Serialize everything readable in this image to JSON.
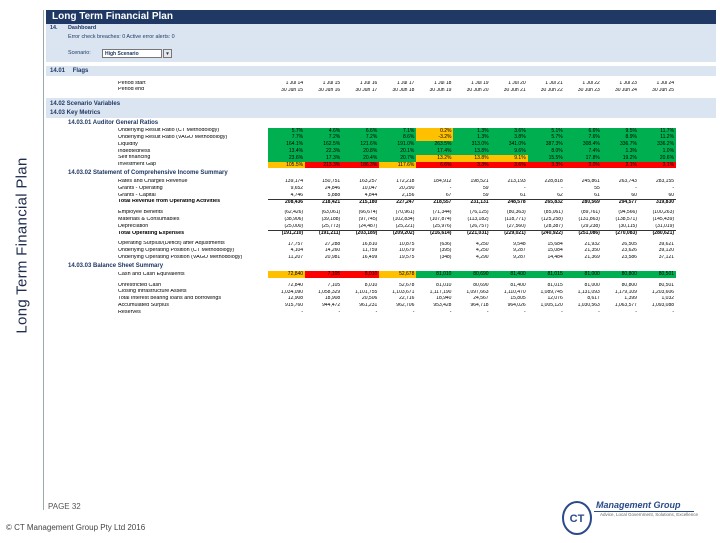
{
  "side_title": "Long Term Financial Plan",
  "sheet_title": "Long Term Financial Plan",
  "dashboard": {
    "number": "14.",
    "title": "Dashboard",
    "alerts": "Error check breaches: 0 Active error alerts: 0",
    "scenario_label": "Scenario:",
    "scenario_value": "High Scenario",
    "dropdown_glyph": "▾"
  },
  "flags": {
    "number": "14.01",
    "title": "Flags"
  },
  "periods": {
    "start_label": "Period start",
    "end_label": "Period end",
    "starts": [
      "1 Jul 14",
      "1 Jul 15",
      "1 Jul 16",
      "1 Jul 17",
      "1 Jul 18",
      "1 Jul 19",
      "1 Jul 20",
      "1 Jul 21",
      "1 Jul 22",
      "1 Jul 23",
      "1 Jul 24"
    ],
    "ends": [
      "30 Jun 15",
      "30 Jun 16",
      "30 Jun 17",
      "30 Jun 18",
      "30 Jun 19",
      "30 Jun 20",
      "30 Jun 21",
      "30 Jun 22",
      "30 Jun 23",
      "30 Jun 24",
      "30 Jun 25"
    ]
  },
  "scenario_vars": {
    "line1": "14.02 Scenario Variables",
    "line2": "14.03 Key Metrics"
  },
  "auditor": {
    "title": "14.03.01  Auditor General Ratios",
    "rows": [
      {
        "label": "Underlying Result Ratio (CT Methodology)",
        "values": [
          "5.7%",
          "4.6%",
          "6.6%",
          "7.1%",
          "0.2%",
          "1.3%",
          "3.6%",
          "5.1%",
          "6.6%",
          "9.5%",
          "11.7%"
        ],
        "colors": [
          "g",
          "g",
          "g",
          "g",
          "y",
          "g",
          "g",
          "g",
          "g",
          "g",
          "g"
        ]
      },
      {
        "label": "Underlying Result Ratio (VAGO Methodology)",
        "values": [
          "7.7%",
          "7.2%",
          "7.2%",
          "8.6%",
          "-3.2%",
          "1.3%",
          "3.8%",
          "5.7%",
          "7.6%",
          "8.9%",
          "11.2%"
        ],
        "colors": [
          "g",
          "g",
          "g",
          "g",
          "y",
          "g",
          "g",
          "g",
          "g",
          "g",
          "g"
        ]
      },
      {
        "label": "Liquidity",
        "values": [
          "164.1%",
          "162.5%",
          "121.6%",
          "191.0%",
          "263.5%",
          "313.0%",
          "341.0%",
          "387.3%",
          "308.4%",
          "336.7%",
          "336.2%"
        ],
        "colors": [
          "g",
          "g",
          "g",
          "g",
          "g",
          "g",
          "g",
          "g",
          "g",
          "g",
          "g"
        ]
      },
      {
        "label": "Indebtedness",
        "values": [
          "13.4%",
          "22.3%",
          "20.8%",
          "20.1%",
          "17.4%",
          "13.8%",
          "9.6%",
          "8.0%",
          "7.4%",
          "1.3%",
          "1.0%"
        ],
        "colors": [
          "g",
          "g",
          "g",
          "g",
          "g",
          "g",
          "g",
          "g",
          "g",
          "g",
          "g"
        ]
      },
      {
        "label": "Self financing",
        "values": [
          "23.6%",
          "17.3%",
          "20.4%",
          "20.7%",
          "13.2%",
          "13.8%",
          "9.1%",
          "15.5%",
          "17.8%",
          "19.2%",
          "20.6%"
        ],
        "colors": [
          "g",
          "g",
          "g",
          "g",
          "y",
          "y",
          "y",
          "g",
          "g",
          "g",
          "g"
        ]
      },
      {
        "label": "Investment Gap",
        "values": [
          "105.5%",
          "213.3%",
          "186.3%",
          "117.6%",
          "6.6%",
          "3.3%",
          "3.6%",
          "3.3%",
          "3.0%",
          "2.1%",
          "3.1%"
        ],
        "colors": [
          "y",
          "r",
          "r",
          "y",
          "r",
          "r",
          "r",
          "r",
          "r",
          "r",
          "r"
        ]
      }
    ]
  },
  "income": {
    "title": "14.03.02  Statement of Comprehensive Income Summary",
    "rows": [
      {
        "label": "Rates and Charges Revenue",
        "values": [
          "139,174",
          "150,751",
          "163,257",
          "172,218",
          "184,912",
          "198,521",
          "213,193",
          "228,818",
          "245,861",
          "263,743",
          "283,155"
        ],
        "style": ""
      },
      {
        "label": "Grants - Operating",
        "values": [
          "9,652",
          "24,846",
          "10,047",
          "20,290",
          "-",
          "59",
          "-",
          "-",
          "55",
          "-",
          "-"
        ],
        "style": ""
      },
      {
        "label": "Grants - Capital",
        "values": [
          "4,746",
          "5,888",
          "4,844",
          "2,156",
          "67",
          "59",
          "61",
          "62",
          "61",
          "60",
          "60"
        ],
        "style": ""
      },
      {
        "label": "Total Revenue from Operating Activities",
        "values": [
          "208,436",
          "218,421",
          "215,180",
          "227,247",
          "218,557",
          "231,131",
          "248,578",
          "265,832",
          "280,569",
          "294,577",
          "319,830"
        ],
        "style": "bold"
      },
      {
        "label": "",
        "values": [],
        "style": "gap"
      },
      {
        "label": "Employee Benefits",
        "values": [
          "(62,426)",
          "(63,061)",
          "(66,674)",
          "(70,961)",
          "(71,344)",
          "(76,125)",
          "(80,363)",
          "(85,061)",
          "(89,761)",
          "(94,566)",
          "(100,263)"
        ],
        "style": ""
      },
      {
        "label": "Materials & Consumables",
        "values": [
          "(38,906)",
          "(39,188)",
          "(97,745)",
          "(102,834)",
          "(107,874)",
          "(113,182)",
          "(118,771)",
          "(125,258)",
          "(131,863)",
          "(138,571)",
          "(145,439)"
        ],
        "style": ""
      },
      {
        "label": "Depreciation",
        "values": [
          "(25,000)",
          "(25,773)",
          "(24,487)",
          "(25,221)",
          "(25,976)",
          "(26,757)",
          "(27,560)",
          "(28,387)",
          "(29,238)",
          "(30,115)",
          "(31,019)"
        ],
        "style": ""
      },
      {
        "label": "Total Operating Expenses",
        "values": [
          "(191,210)",
          "(191,211)",
          "(203,189)",
          "(209,202)",
          "(216,614)",
          "(221,031)",
          "(229,021)",
          "(240,922)",
          "(251,086)",
          "(270,083)",
          "(280,621)"
        ],
        "style": "bold"
      },
      {
        "label": "",
        "values": [],
        "style": "gap"
      },
      {
        "label": "Operating Surplus/(Deficit) after Adjustments",
        "values": [
          "17,757",
          "27,288",
          "16,810",
          "10,875",
          "(636)",
          "4,250",
          "9,548",
          "15,684",
          "21,932",
          "26,505",
          "39,621"
        ],
        "style": ""
      },
      {
        "label": "Underlying Operating Position (CT Methodology)",
        "values": [
          "4,104",
          "14,260",
          "11,759",
          "10,679",
          "(395)",
          "4,250",
          "9,287",
          "15,084",
          "21,350",
          "23,626",
          "39,120"
        ],
        "style": ""
      },
      {
        "label": "Underlying Operating Position (VAGO Methodology)",
        "values": [
          "11,207",
          "20,981",
          "16,499",
          "19,575",
          "(348)",
          "4,290",
          "9,287",
          "14,484",
          "21,369",
          "23,586",
          "37,121"
        ],
        "style": ""
      }
    ]
  },
  "balance": {
    "title": "14.03.03  Balance Sheet Summary",
    "rows": [
      {
        "label": "Cash and Cash Equivalents",
        "values": [
          "72,840",
          "7,105",
          "8,010",
          "52,678",
          "81,010",
          "80,690",
          "81,400",
          "81,015",
          "81,000",
          "80,800",
          "80,501"
        ],
        "colors": [
          "y",
          "r",
          "r",
          "y",
          "g",
          "g",
          "g",
          "g",
          "g",
          "g",
          "g"
        ]
      },
      {
        "label": "",
        "values": [],
        "colors": [],
        "gap": true
      },
      {
        "label": "Unrestricted Cash",
        "values": [
          "72,840",
          "7,105",
          "8,010",
          "52,678",
          "81,010",
          "80,690",
          "81,400",
          "81,015",
          "81,000",
          "80,800",
          "80,501"
        ],
        "colors": []
      },
      {
        "label": "Closing Infrastructure Assets",
        "values": [
          "1,034,090",
          "1,058,329",
          "1,101,755",
          "1,103,671",
          "1,117,190",
          "1,097,663",
          "1,110,470",
          "1,089,745",
          "1,131,093",
          "1,179,109",
          "1,203,606"
        ],
        "colors": []
      },
      {
        "label": "Total Interest bearing loans and borrowings",
        "values": [
          "12,908",
          "18,908",
          "20,506",
          "22,716",
          "18,940",
          "24,567",
          "15,805",
          "12,076",
          "8,617",
          "1,399",
          "1,032"
        ],
        "colors": []
      },
      {
        "label": "Accumulated Surplus",
        "values": [
          "915,760",
          "944,472",
          "961,231",
          "962,706",
          "953,428",
          "964,718",
          "964,026",
          "1,005,120",
          "1,030,563",
          "1,063,577",
          "1,093,088"
        ],
        "colors": []
      },
      {
        "label": "Reserves",
        "values": [
          "-",
          "-",
          "-",
          "-",
          "-",
          "-",
          "-",
          "-",
          "-",
          "-",
          "-"
        ],
        "colors": []
      }
    ]
  },
  "footer": {
    "page": "PAGE 32",
    "copyright": "© CT Management Group Pty Ltd 2016",
    "logo_word": "Management Group",
    "logo_initials": "CT",
    "logo_tagline": "Advice, Local Government, Solutions, Excellence"
  },
  "colors": {
    "navy": "#1f3864",
    "green": "#00b050",
    "yellow": "#ffc000",
    "red": "#ff0000",
    "band": "#dbe5f1"
  }
}
